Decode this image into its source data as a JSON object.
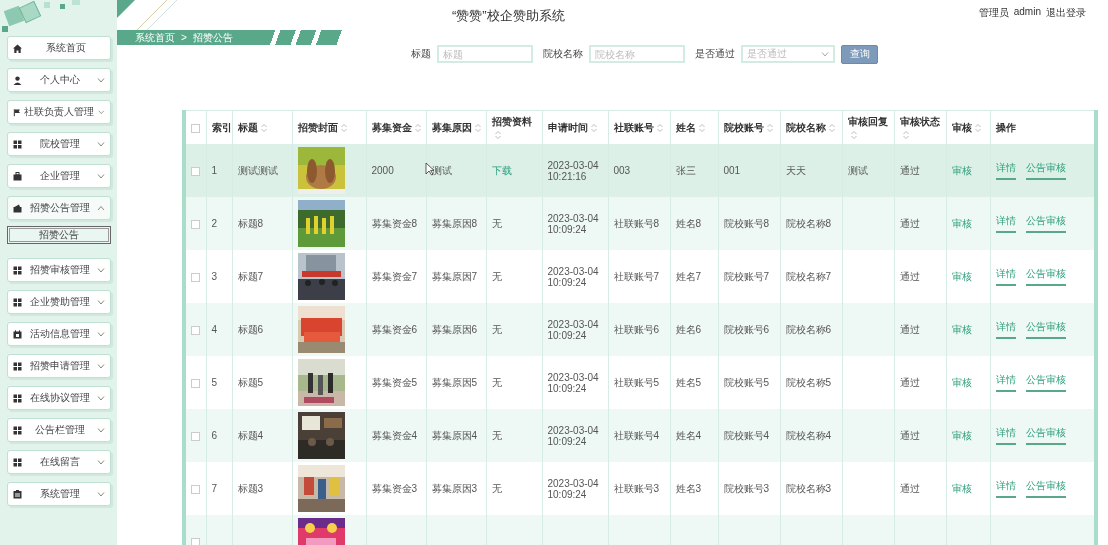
{
  "header": {
    "title": "“赞赞”校企赞助系统",
    "role": "管理员",
    "username": "admin",
    "logout": "退出登录"
  },
  "breadcrumb": {
    "items": [
      "系统首页",
      "招赞公告"
    ],
    "separator": ">"
  },
  "search": {
    "fields": [
      {
        "kind": "input",
        "label": "标题",
        "placeholder": "标题"
      },
      {
        "kind": "input",
        "label": "院校名称",
        "placeholder": "院校名称"
      },
      {
        "kind": "select",
        "label": "是否通过",
        "placeholder": "是否通过"
      }
    ],
    "button": "查询"
  },
  "sidebar": {
    "items": [
      {
        "label": "系统首页",
        "expandable": false
      },
      {
        "label": "个人中心",
        "expandable": true,
        "expanded": false
      },
      {
        "label": "社联负责人管理",
        "expandable": true,
        "expanded": false
      },
      {
        "label": "院校管理",
        "expandable": true,
        "expanded": false
      },
      {
        "label": "企业管理",
        "expandable": true,
        "expanded": false
      },
      {
        "label": "招赞公告管理",
        "expandable": true,
        "expanded": true,
        "children": [
          {
            "label": "招赞公告",
            "selected": true
          }
        ]
      },
      {
        "label": "招赞审核管理",
        "expandable": true,
        "expanded": false
      },
      {
        "label": "企业赞助管理",
        "expandable": true,
        "expanded": false
      },
      {
        "label": "活动信息管理",
        "expandable": true,
        "expanded": false
      },
      {
        "label": "招赞申请管理",
        "expandable": true,
        "expanded": false
      },
      {
        "label": "在线协议管理",
        "expandable": true,
        "expanded": false
      },
      {
        "label": "公告栏管理",
        "expandable": true,
        "expanded": false
      },
      {
        "label": "在线留言",
        "expandable": true,
        "expanded": false
      },
      {
        "label": "系统管理",
        "expandable": true,
        "expanded": false
      }
    ]
  },
  "table": {
    "columns": [
      {
        "kind": "checkbox",
        "checked": false
      },
      {
        "label": "索引",
        "sortable": false
      },
      {
        "label": "标题",
        "sortable": true
      },
      {
        "label": "招赞封面",
        "sortable": true
      },
      {
        "label": "募集资金",
        "sortable": true
      },
      {
        "label": "募集原因",
        "sortable": true
      },
      {
        "label": "招赞资料",
        "sortable": true
      },
      {
        "label": "申请时间",
        "sortable": true
      },
      {
        "label": "社联账号",
        "sortable": true
      },
      {
        "label": "姓名",
        "sortable": true
      },
      {
        "label": "院校账号",
        "sortable": true
      },
      {
        "label": "院校名称",
        "sortable": true
      },
      {
        "label": "审核回复",
        "sortable": true
      },
      {
        "label": "审核状态",
        "sortable": true
      },
      {
        "label": "审核",
        "sortable": true
      },
      {
        "label": "操作",
        "sortable": false
      }
    ],
    "rows": [
      {
        "hovered": true,
        "checked": false,
        "index": "1",
        "title": "测试测试",
        "cover": {
          "kind": "picture"
        },
        "funds": "2000",
        "reason": "测试",
        "material": {
          "kind": "link",
          "text": "下载"
        },
        "time": "2023-03-04 10:21:16",
        "account": "003",
        "name": "张三",
        "school_account": "001",
        "school_name": "天天",
        "reply": "测试",
        "status": "通过",
        "audit": "审核",
        "actions": [
          "详情",
          "公告审核"
        ]
      },
      {
        "hovered": false,
        "checked": false,
        "index": "2",
        "title": "标题8",
        "cover": {
          "kind": "picture"
        },
        "funds": "募集资金8",
        "reason": "募集原因8",
        "material": {
          "kind": "text",
          "text": "无"
        },
        "time": "2023-03-04 10:09:24",
        "account": "社联账号8",
        "name": "姓名8",
        "school_account": "院校账号8",
        "school_name": "院校名称8",
        "status": "通过",
        "audit": "审核",
        "actions": [
          "详情",
          "公告审核"
        ]
      },
      {
        "hovered": false,
        "checked": false,
        "index": "3",
        "title": "标题7",
        "cover": {
          "kind": "picture"
        },
        "funds": "募集资金7",
        "reason": "募集原因7",
        "material": {
          "kind": "text",
          "text": "无"
        },
        "time": "2023-03-04 10:09:24",
        "account": "社联账号7",
        "name": "姓名7",
        "school_account": "院校账号7",
        "school_name": "院校名称7",
        "status": "通过",
        "audit": "审核",
        "actions": [
          "详情",
          "公告审核"
        ]
      },
      {
        "hovered": false,
        "checked": false,
        "index": "4",
        "title": "标题6",
        "cover": {
          "kind": "picture"
        },
        "funds": "募集资金6",
        "reason": "募集原因6",
        "material": {
          "kind": "text",
          "text": "无"
        },
        "time": "2023-03-04 10:09:24",
        "account": "社联账号6",
        "name": "姓名6",
        "school_account": "院校账号6",
        "school_name": "院校名称6",
        "status": "通过",
        "audit": "审核",
        "actions": [
          "详情",
          "公告审核"
        ]
      },
      {
        "hovered": false,
        "checked": false,
        "index": "5",
        "title": "标题5",
        "cover": {
          "kind": "picture"
        },
        "funds": "募集资金5",
        "reason": "募集原因5",
        "material": {
          "kind": "text",
          "text": "无"
        },
        "time": "2023-03-04 10:09:24",
        "account": "社联账号5",
        "name": "姓名5",
        "school_account": "院校账号5",
        "school_name": "院校名称5",
        "status": "通过",
        "audit": "审核",
        "actions": [
          "详情",
          "公告审核"
        ]
      },
      {
        "hovered": false,
        "checked": false,
        "index": "6",
        "title": "标题4",
        "cover": {
          "kind": "picture"
        },
        "funds": "募集资金4",
        "reason": "募集原因4",
        "material": {
          "kind": "text",
          "text": "无"
        },
        "time": "2023-03-04 10:09:24",
        "account": "社联账号4",
        "name": "姓名4",
        "school_account": "院校账号4",
        "school_name": "院校名称4",
        "status": "通过",
        "audit": "审核",
        "actions": [
          "详情",
          "公告审核"
        ]
      },
      {
        "hovered": false,
        "checked": false,
        "index": "7",
        "title": "标题3",
        "cover": {
          "kind": "picture"
        },
        "funds": "募集资金3",
        "reason": "募集原因3",
        "material": {
          "kind": "text",
          "text": "无"
        },
        "time": "2023-03-04 10:09:24",
        "account": "社联账号3",
        "name": "姓名3",
        "school_account": "院校账号3",
        "school_name": "院校名称3",
        "status": "通过",
        "audit": "审核",
        "actions": [
          "详情",
          "公告审核"
        ]
      },
      {
        "hovered": false,
        "checked": false,
        "cover": {
          "kind": "picture"
        }
      }
    ]
  }
}
